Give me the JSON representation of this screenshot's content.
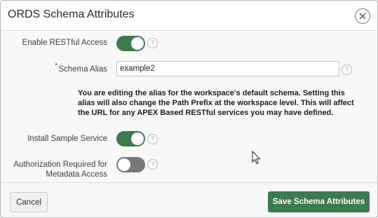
{
  "dialog": {
    "title": "ORDS Schema Attributes"
  },
  "form": {
    "enable_restful": {
      "label": "Enable RESTful Access",
      "state": "on"
    },
    "schema_alias": {
      "label": "Schema Alias",
      "required_marker": "*",
      "value": "example2"
    },
    "notice_text": "You are editing the alias for the workspace's default schema. Setting this alias will also change the Path Prefix at the workspace level. This will affect the URL for any APEX Based RESTful services you may have defined.",
    "install_sample": {
      "label": "Install Sample Service",
      "state": "on"
    },
    "auth_required": {
      "label_line1": "Authorization Required for",
      "label_line2": "Metadata Access",
      "state": "off"
    },
    "help_glyph": "?"
  },
  "footer": {
    "cancel_label": "Cancel",
    "save_label": "Save Schema Attributes"
  },
  "colors": {
    "accent": "#3b7b4e",
    "toggle_off": "#777777",
    "required": "#c0392b"
  },
  "icons": [
    "close-icon",
    "help-icon",
    "mouse-pointer-icon"
  ]
}
